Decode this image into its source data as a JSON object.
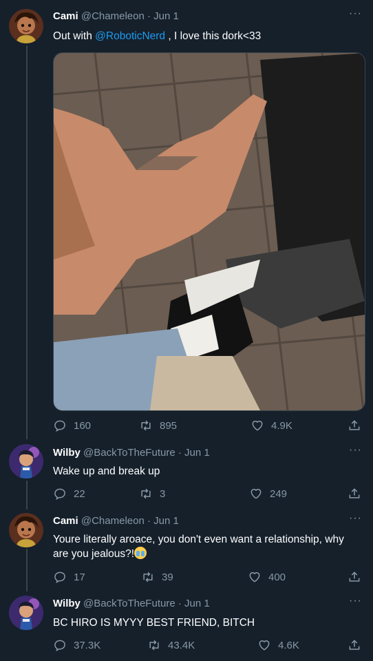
{
  "tweets": [
    {
      "name": "Cami",
      "handle": "@Chameleon",
      "date": "Jun 1",
      "text_before": "Out with ",
      "mention": "@RoboticNerd",
      "text_after": " , I love this dork<33",
      "replies": "160",
      "retweets": "895",
      "likes": "4.9K"
    },
    {
      "name": "Wilby",
      "handle": "@BackToTheFuture",
      "date": "Jun 1",
      "text": "Wake up and break up",
      "replies": "22",
      "retweets": "3",
      "likes": "249"
    },
    {
      "name": "Cami",
      "handle": "@Chameleon",
      "date": "Jun 1",
      "text": "Youre literally aroace, you don't even want a relationship, why are you jealous?!",
      "emoji_icon": "loudly-crying-face",
      "replies": "17",
      "retweets": "39",
      "likes": "400"
    },
    {
      "name": "Wilby",
      "handle": "@BackToTheFuture",
      "date": "Jun 1",
      "text": "BC HIRO IS MYYY BEST FRIEND, BITCH",
      "replies": "37.3K",
      "retweets": "43.4K",
      "likes": "4.6K"
    }
  ],
  "separator": "·",
  "more_label": "···",
  "colors": {
    "background": "#15202b",
    "secondary_text": "#8899a6",
    "mention": "#1d9bf0",
    "line": "#38444d"
  }
}
